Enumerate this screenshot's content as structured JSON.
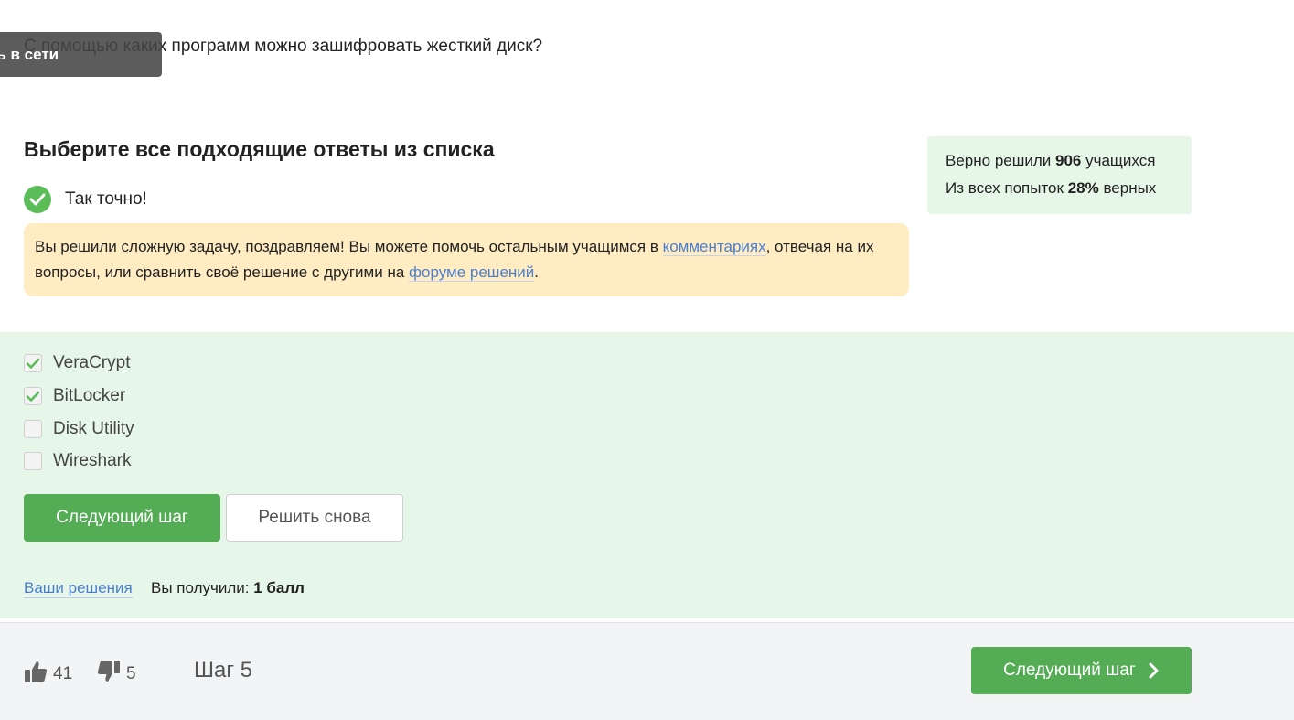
{
  "question": "С помощью каких программ можно зашифровать жесткий диск?",
  "online_tooltip": "ть в сети",
  "task_title": "Выберите все подходящие ответы из списка",
  "feedback": {
    "status": "Так точно!",
    "congrats_part1": "Вы решили сложную задачу, поздравляем! Вы можете помочь остальным учащимся в ",
    "comments_link": "комментариях",
    "congrats_part2": ", отвечая на их вопросы, или сравнить своё решение с другими на ",
    "forum_link": "форуме решений",
    "congrats_part3": "."
  },
  "stats": {
    "solved_prefix": "Верно решили ",
    "solved_count": "906",
    "solved_suffix": " учащихся",
    "attempts_prefix": "Из всех попыток ",
    "attempts_percent": "28%",
    "attempts_suffix": " верных"
  },
  "options": [
    {
      "label": "VeraCrypt",
      "checked": true
    },
    {
      "label": "BitLocker",
      "checked": true
    },
    {
      "label": "Disk Utility",
      "checked": false
    },
    {
      "label": "Wireshark",
      "checked": false
    }
  ],
  "buttons": {
    "next_step": "Следующий шаг",
    "retry": "Решить снова"
  },
  "result": {
    "solutions_link": "Ваши решения",
    "score_prefix": "Вы получили: ",
    "score_value": "1 балл"
  },
  "footer": {
    "likes": "41",
    "dislikes": "5",
    "step": "Шаг 5",
    "next_step": "Следующий шаг"
  },
  "colors": {
    "green": "#54ad54",
    "link": "#4a7fd0",
    "feedback_bg": "#ffecc3",
    "answer_bg": "#e6f7ea"
  }
}
